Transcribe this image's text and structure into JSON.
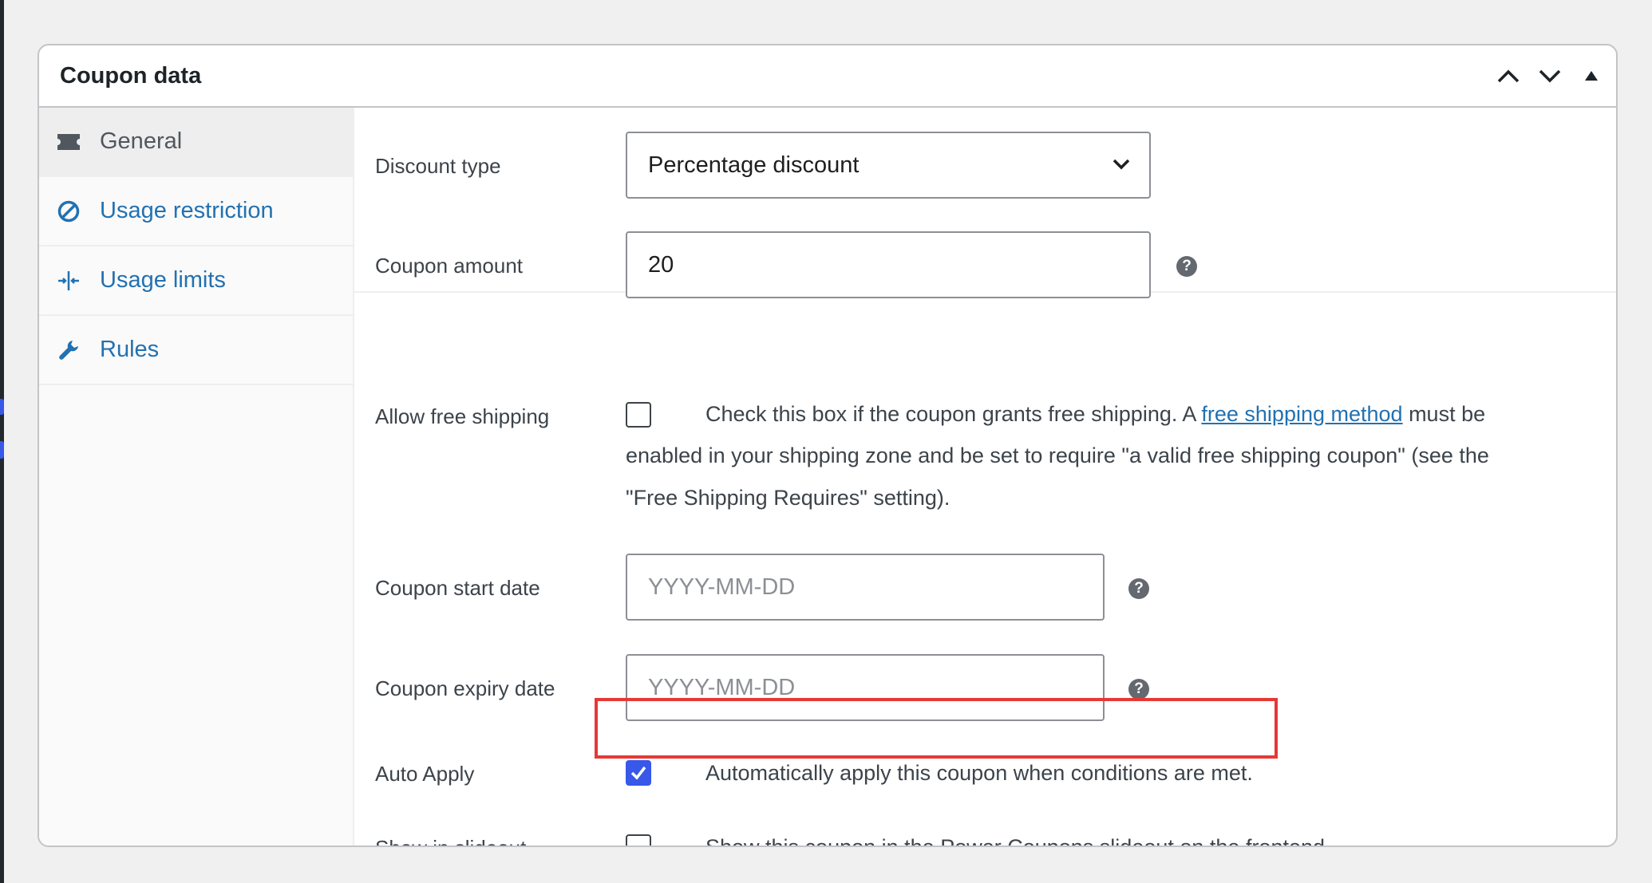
{
  "panel": {
    "title": "Coupon data"
  },
  "sidebar": {
    "tabs": [
      {
        "label": "General",
        "icon": "ticket-icon",
        "active": true
      },
      {
        "label": "Usage restriction",
        "icon": "prohibited-icon",
        "active": false
      },
      {
        "label": "Usage limits",
        "icon": "limits-icon",
        "active": false
      },
      {
        "label": "Rules",
        "icon": "wrench-icon",
        "active": false
      }
    ]
  },
  "fields": {
    "discount_type": {
      "label": "Discount type",
      "value": "Percentage discount"
    },
    "coupon_amount": {
      "label": "Coupon amount",
      "value": "20"
    },
    "free_shipping": {
      "label": "Allow free shipping",
      "checked": false,
      "text_before": "Check this box if the coupon grants free shipping. A ",
      "link": "free shipping method",
      "text_after": " must be",
      "line2": "enabled in your shipping zone and be set to require \"a valid free shipping coupon\" (see the",
      "line3": "\"Free Shipping Requires\" setting)."
    },
    "start_date": {
      "label": "Coupon start date",
      "placeholder": "YYYY-MM-DD"
    },
    "expiry_date": {
      "label": "Coupon expiry date",
      "placeholder": "YYYY-MM-DD"
    },
    "auto_apply": {
      "label": "Auto Apply",
      "checked": true,
      "text": "Automatically apply this coupon when conditions are met."
    },
    "slideout": {
      "label": "Show in slideout",
      "checked": false,
      "text": "Show this coupon in the Power Coupons slideout on the frontend."
    }
  },
  "colors": {
    "accent": "#3858e9",
    "link": "#2271b1",
    "highlight": "#e53935"
  }
}
